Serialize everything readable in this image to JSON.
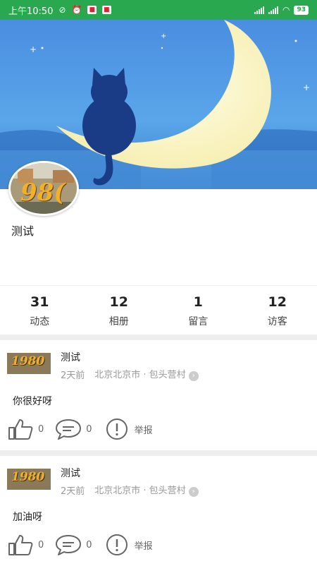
{
  "status_bar": {
    "time": "上午10:50",
    "battery": "93"
  },
  "profile": {
    "avatar_text": "98(",
    "username": "测试"
  },
  "stats": [
    {
      "value": "31",
      "label": "动态"
    },
    {
      "value": "12",
      "label": "相册"
    },
    {
      "value": "1",
      "label": "留言"
    },
    {
      "value": "12",
      "label": "访客"
    }
  ],
  "posts": [
    {
      "thumb_text": "1980",
      "author": "测试",
      "time": "2天前",
      "location": "北京北京市 · 包头营村",
      "content": "你很好呀",
      "likes": "0",
      "comments": "0",
      "report_label": "举报"
    },
    {
      "thumb_text": "1980",
      "author": "测试",
      "time": "2天前",
      "location": "北京北京市 · 包头营村",
      "content": "加油呀",
      "likes": "0",
      "comments": "0",
      "report_label": "举报"
    }
  ]
}
